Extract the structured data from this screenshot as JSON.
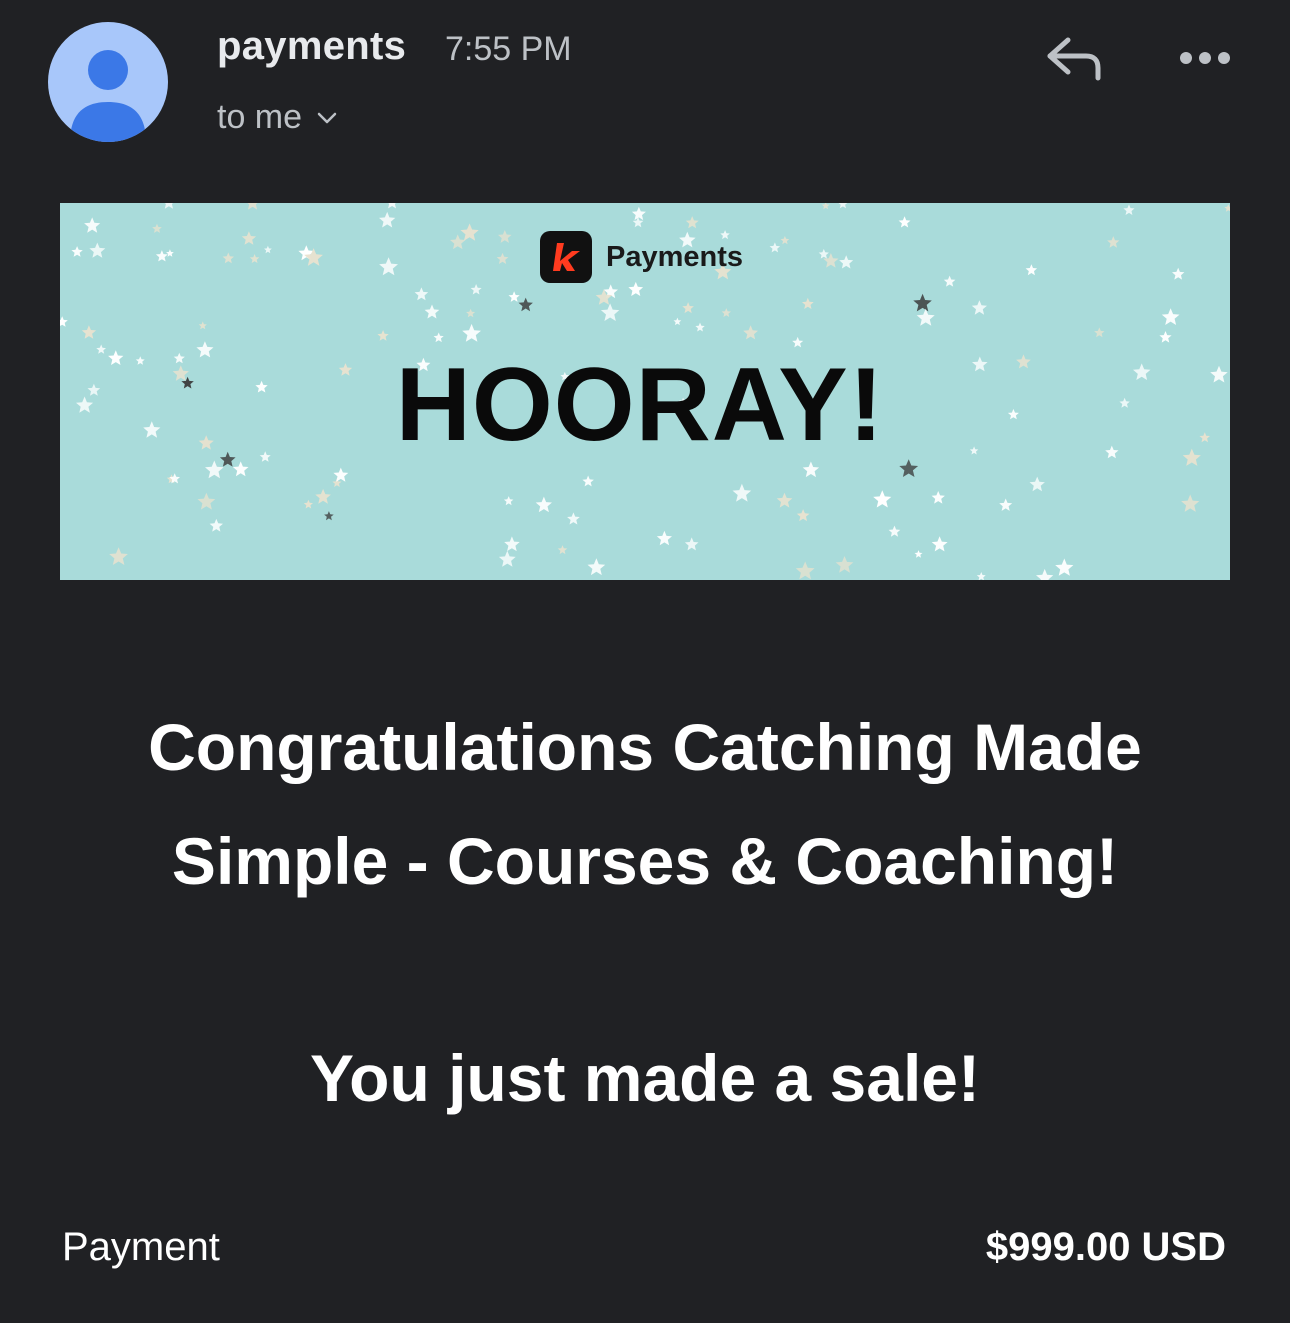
{
  "header": {
    "sender": "payments",
    "time": "7:55 PM",
    "recipient_label": "to me",
    "icons": [
      "avatar-person-icon",
      "chevron-down-icon",
      "reply-icon",
      "more-dots-icon"
    ]
  },
  "banner": {
    "brand_name": "Payments",
    "logo_letter": "k",
    "title": "HOORAY!",
    "colors": {
      "background": "#a9dbda",
      "logo_accent": "#ff3b1f"
    }
  },
  "message": {
    "headline": "Congratulations Catching Made Simple - Courses & Coaching!",
    "subline": "You just made a sale!"
  },
  "payment": {
    "label": "Payment",
    "amount": "$999.00 USD"
  },
  "theme": {
    "background": "#202124",
    "avatar_bg": "#a8c7fa",
    "avatar_fg": "#3b78e7"
  }
}
